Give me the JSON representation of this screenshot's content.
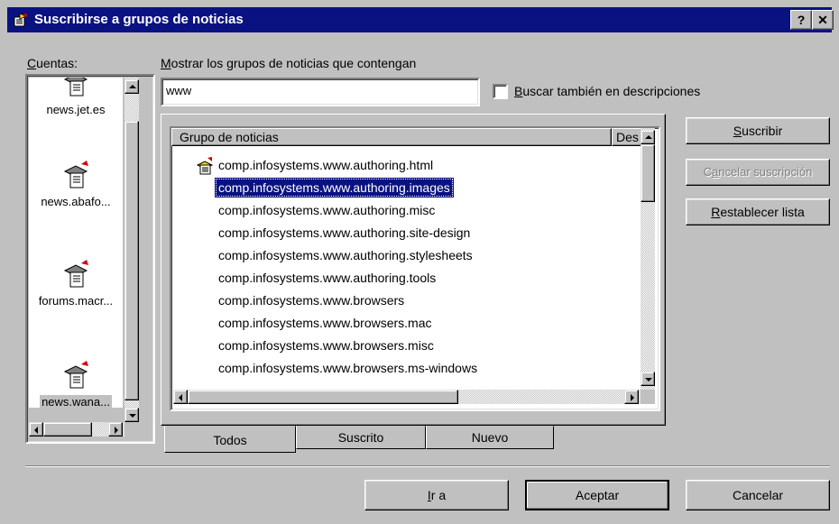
{
  "window": {
    "title": "Suscribirse a grupos de noticias",
    "help_button": "?",
    "close_button": "✕"
  },
  "accounts": {
    "label_accel": "C",
    "label_rest": "uentas:",
    "items": [
      {
        "label": "news.jet.es"
      },
      {
        "label": "news.abafo..."
      },
      {
        "label": "forums.macr..."
      },
      {
        "label": "news.wana..."
      }
    ]
  },
  "filter": {
    "label_accel": "M",
    "label_rest": "ostrar los grupos de noticias que contengan",
    "value": "www",
    "checkbox_accel": "B",
    "checkbox_rest": "uscar también en descripciones",
    "checked": false
  },
  "list": {
    "columns": [
      "Grupo de noticias",
      "Des"
    ],
    "rows": [
      "comp.infosystems.www.authoring.html",
      "comp.infosystems.www.authoring.images",
      "comp.infosystems.www.authoring.misc",
      "comp.infosystems.www.authoring.site-design",
      "comp.infosystems.www.authoring.stylesheets",
      "comp.infosystems.www.authoring.tools",
      "comp.infosystems.www.browsers",
      "comp.infosystems.www.browsers.mac",
      "comp.infosystems.www.browsers.misc",
      "comp.infosystems.www.browsers.ms-windows"
    ],
    "selected_index": 1,
    "subscribed_index": 0
  },
  "side_buttons": {
    "subscribe_accel": "S",
    "subscribe_rest": "uscribir",
    "unsubscribe_pre": "C",
    "unsubscribe_accel": "a",
    "unsubscribe_rest": "ncelar suscripción",
    "reset_accel": "R",
    "reset_rest": "establecer lista"
  },
  "tabs": [
    "Todos",
    "Suscrito",
    "Nuevo"
  ],
  "footer": {
    "goto_accel": "I",
    "goto_rest": "r a",
    "ok": "Aceptar",
    "cancel": "Cancelar"
  }
}
